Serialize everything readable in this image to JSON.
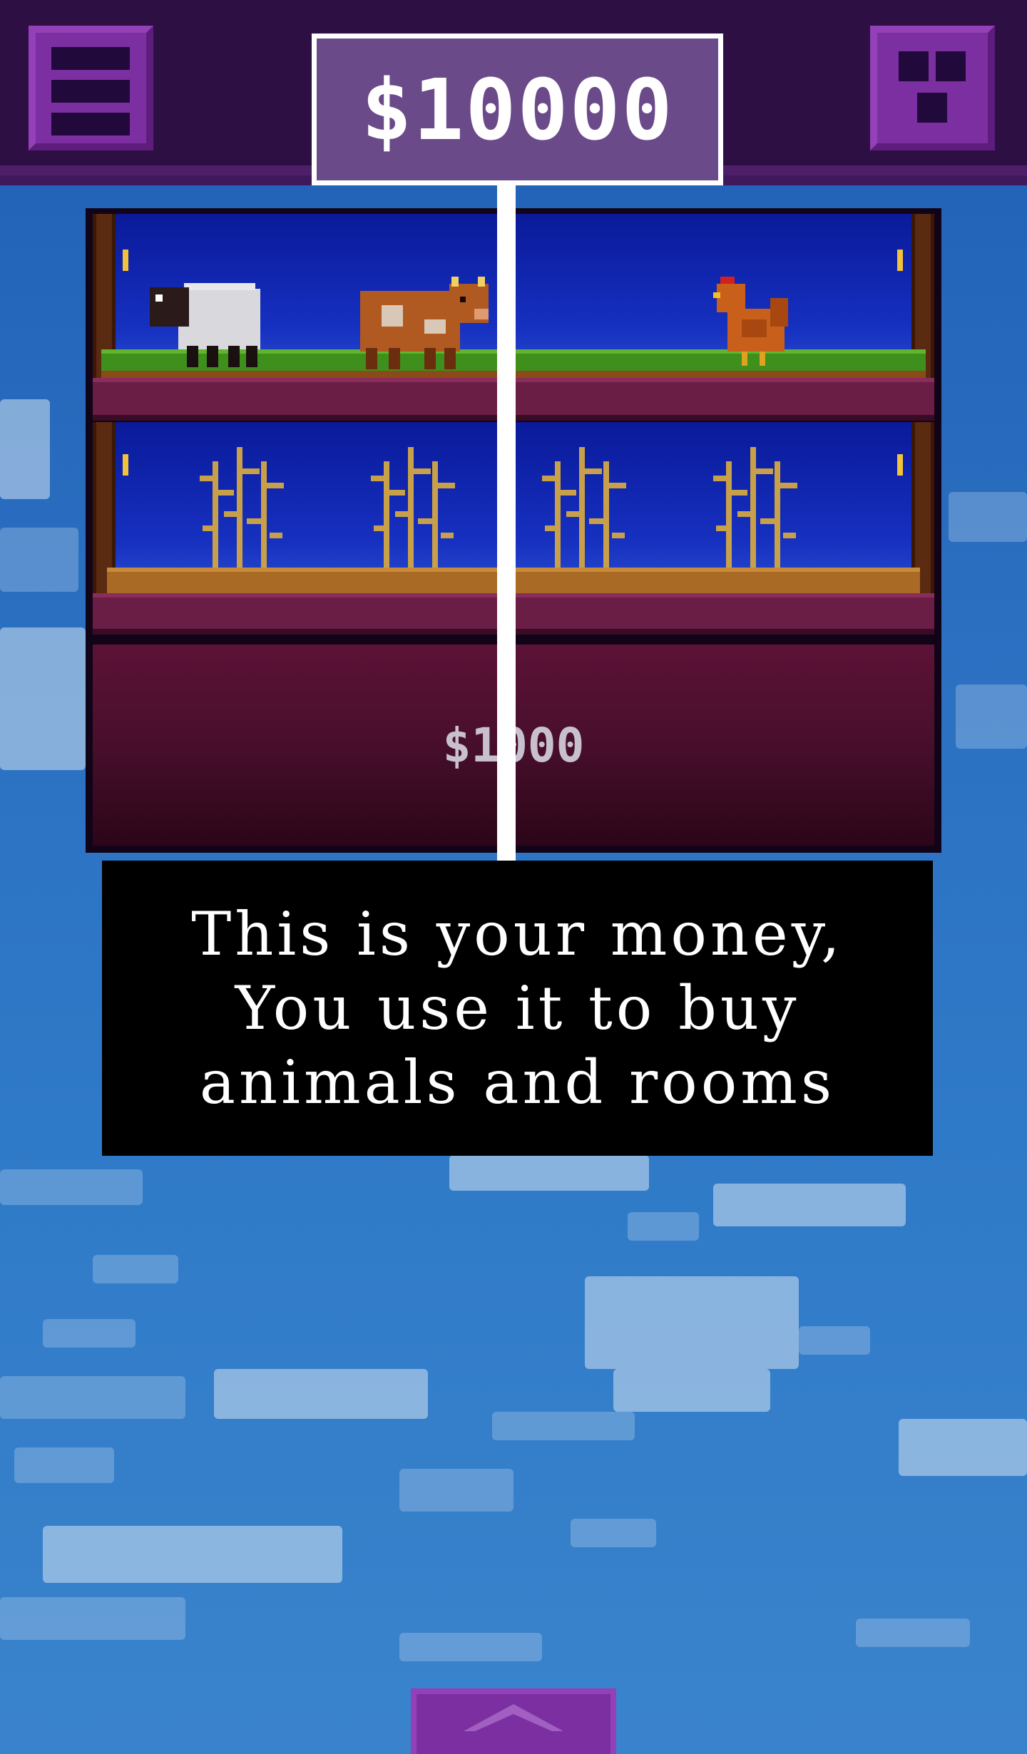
{
  "hud": {
    "money": "$10000",
    "menu_icon": "menu-icon",
    "rooms_icon": "grid-icon"
  },
  "rooms": [
    {
      "type": "pasture",
      "animals": [
        "sheep",
        "cow",
        "chicken"
      ]
    },
    {
      "type": "cornfield",
      "crops": [
        "corn",
        "corn",
        "corn",
        "corn"
      ]
    }
  ],
  "locked_room": {
    "price": "$1000"
  },
  "tutorial": {
    "line1": "This is your money,",
    "line2": "You use it to buy",
    "line3": "animals and rooms"
  },
  "bottom": {
    "icon": "chevron-up-icon"
  },
  "colors": {
    "hud_bg": "#2e0f44",
    "button": "#7c2fa0",
    "money_box": "#6b4a8a",
    "sky": "#2b6fc1"
  }
}
